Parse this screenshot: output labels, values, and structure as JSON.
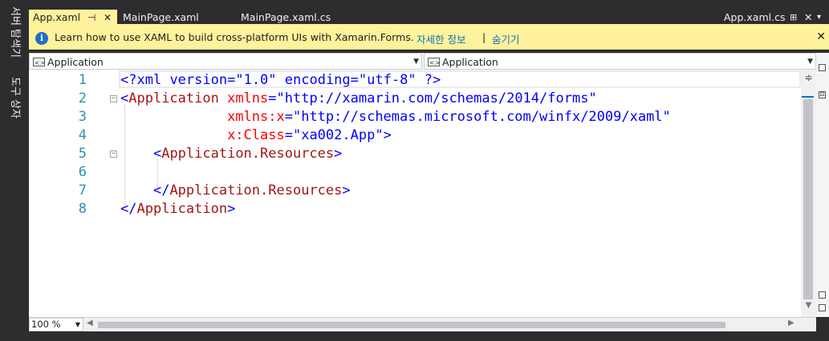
{
  "side_tabs": [
    "서버 탐색기",
    "도구 상자"
  ],
  "tabs": [
    {
      "label": "App.xaml",
      "active": true
    },
    {
      "label": "MainPage.xaml",
      "active": false
    },
    {
      "label": "MainPage.xaml.cs",
      "active": false
    }
  ],
  "right_tab": {
    "label": "App.xaml.cs"
  },
  "infobar": {
    "message": "Learn how to use XAML to build cross-platform UIs with Xamarin.Forms.",
    "link_more": "자세한 정보",
    "separator": "|",
    "link_hide": "숨기기"
  },
  "nav": {
    "left_dropdown": "Application",
    "right_dropdown": "Application"
  },
  "editor": {
    "line_numbers": [
      "1",
      "2",
      "3",
      "4",
      "5",
      "6",
      "7",
      "8"
    ],
    "lines": {
      "l1": {
        "open": "<?",
        "name": "xml",
        "a1": " version",
        "eq1": "=",
        "v1": "\"1.0\"",
        "a2": " encoding",
        "eq2": "=",
        "v2": "\"utf-8\"",
        "close": " ?>"
      },
      "l2": {
        "open": "<",
        "name": "Application",
        "a1": " xmlns",
        "eq1": "=",
        "v1": "\"http://xamarin.com/schemas/2014/forms\""
      },
      "l3": {
        "indent": "             ",
        "a1": "xmlns:x",
        "eq1": "=",
        "v1": "\"http://schemas.microsoft.com/winfx/2009/xaml\""
      },
      "l4": {
        "indent": "             ",
        "a1": "x:Class",
        "eq1": "=",
        "v1": "\"xa002.App\"",
        "close": ">"
      },
      "l5": {
        "indent": "    ",
        "open": "<",
        "name": "Application.Resources",
        "close": ">"
      },
      "l6": {
        "text": ""
      },
      "l7": {
        "indent": "    ",
        "open": "</",
        "name": "Application.Resources",
        "close": ">"
      },
      "l8": {
        "open": "</",
        "name": "Application",
        "close": ">"
      }
    }
  },
  "zoom": "100 %",
  "colors": {
    "active_tab": "#fff29d",
    "line_number": "#2b91af",
    "xml_tag": "#a31515",
    "xml_attr": "#ff0000",
    "xml_value": "#0000ff"
  }
}
